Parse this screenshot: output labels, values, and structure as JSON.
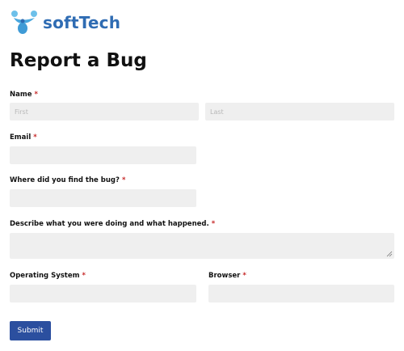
{
  "brand": {
    "name": "softTech",
    "color": "#2f6cb3"
  },
  "page": {
    "title": "Report a Bug"
  },
  "form": {
    "required_marker": "*",
    "name": {
      "label": "Name",
      "first_placeholder": "First",
      "last_placeholder": "Last",
      "first_value": "",
      "last_value": ""
    },
    "email": {
      "label": "Email",
      "value": ""
    },
    "location": {
      "label": "Where did you find the bug?",
      "value": ""
    },
    "description": {
      "label": "Describe what you were doing and what happened.",
      "value": ""
    },
    "os": {
      "label": "Operating System",
      "value": ""
    },
    "browser": {
      "label": "Browser",
      "value": ""
    },
    "submit_label": "Submit"
  },
  "colors": {
    "accent": "#2b4f9f",
    "required": "#c62828",
    "field_bg": "#efefef"
  }
}
